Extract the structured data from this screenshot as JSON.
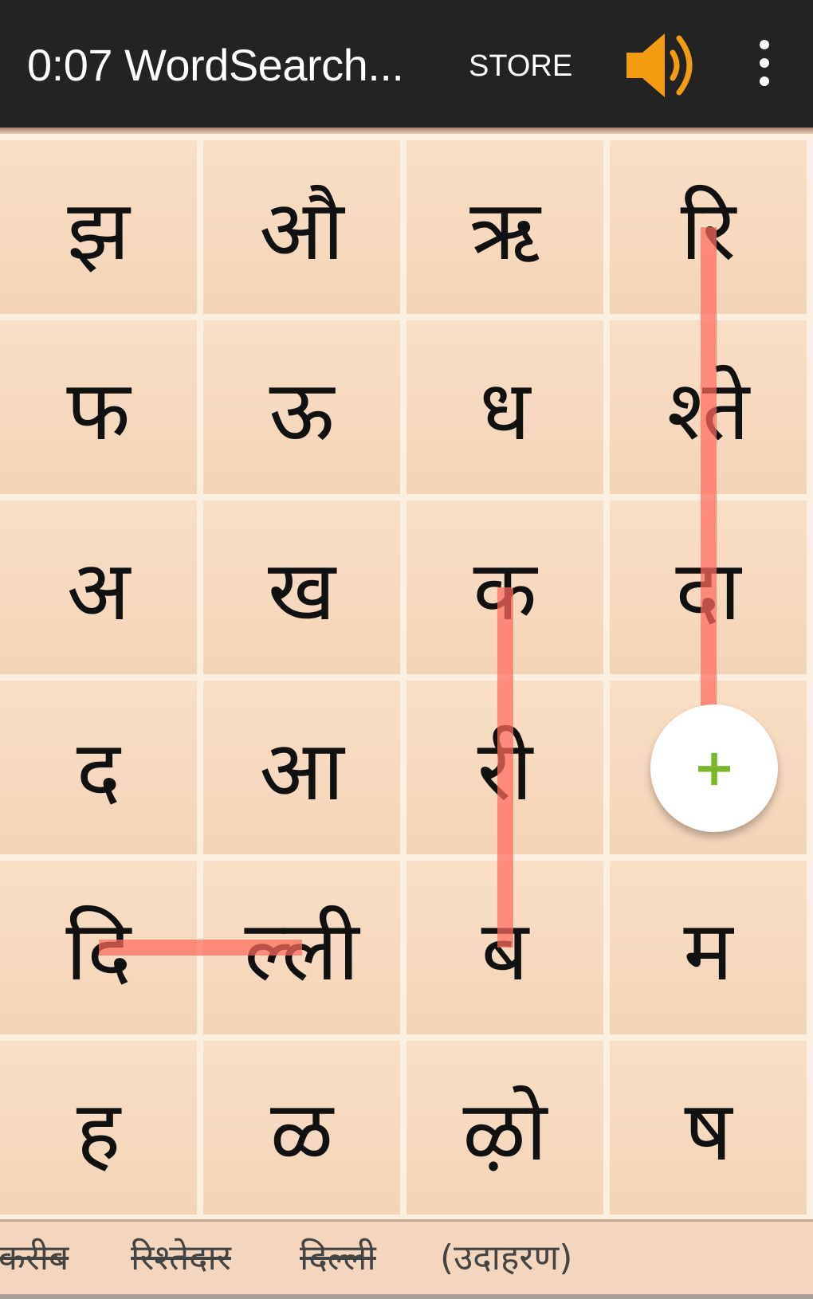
{
  "app_bar": {
    "title": "0:07 WordSearch...",
    "store_label": "STORE",
    "sound_icon": "speaker-on-icon",
    "menu_icon": "overflow-menu-icon",
    "accent_color": "#f39c12"
  },
  "grid": {
    "rows": 6,
    "cols": 4,
    "cells": [
      [
        "झ",
        "औ",
        "ऋ",
        "रि"
      ],
      [
        "फ",
        "ऊ",
        "ध",
        "श्ते"
      ],
      [
        "अ",
        "ख",
        "क",
        "दा"
      ],
      [
        "द",
        "आ",
        "री",
        ""
      ],
      [
        "दि",
        "ल्ली",
        "ब",
        "म"
      ],
      [
        "ह",
        "ळ",
        "ऴो",
        "ष"
      ]
    ],
    "highlight_color": "#ff6b5e",
    "found_paths": [
      {
        "word": "रिश्तेदार",
        "cells": [
          [
            0,
            3
          ],
          [
            1,
            3
          ],
          [
            2,
            3
          ],
          [
            3,
            3
          ]
        ]
      },
      {
        "word": "करीब",
        "cells": [
          [
            2,
            2
          ],
          [
            3,
            2
          ],
          [
            4,
            2
          ]
        ]
      },
      {
        "word": "दिल्ली",
        "cells": [
          [
            4,
            0
          ],
          [
            4,
            1
          ]
        ]
      }
    ]
  },
  "fab": {
    "icon": "plus-icon",
    "symbol": "+",
    "color": "#78b82a"
  },
  "word_list": [
    {
      "text": "करीब",
      "found": true
    },
    {
      "text": "रिश्तेदार",
      "found": true
    },
    {
      "text": "दिल्ली",
      "found": true
    },
    {
      "text": "(उदाहरण)",
      "found": false
    }
  ]
}
